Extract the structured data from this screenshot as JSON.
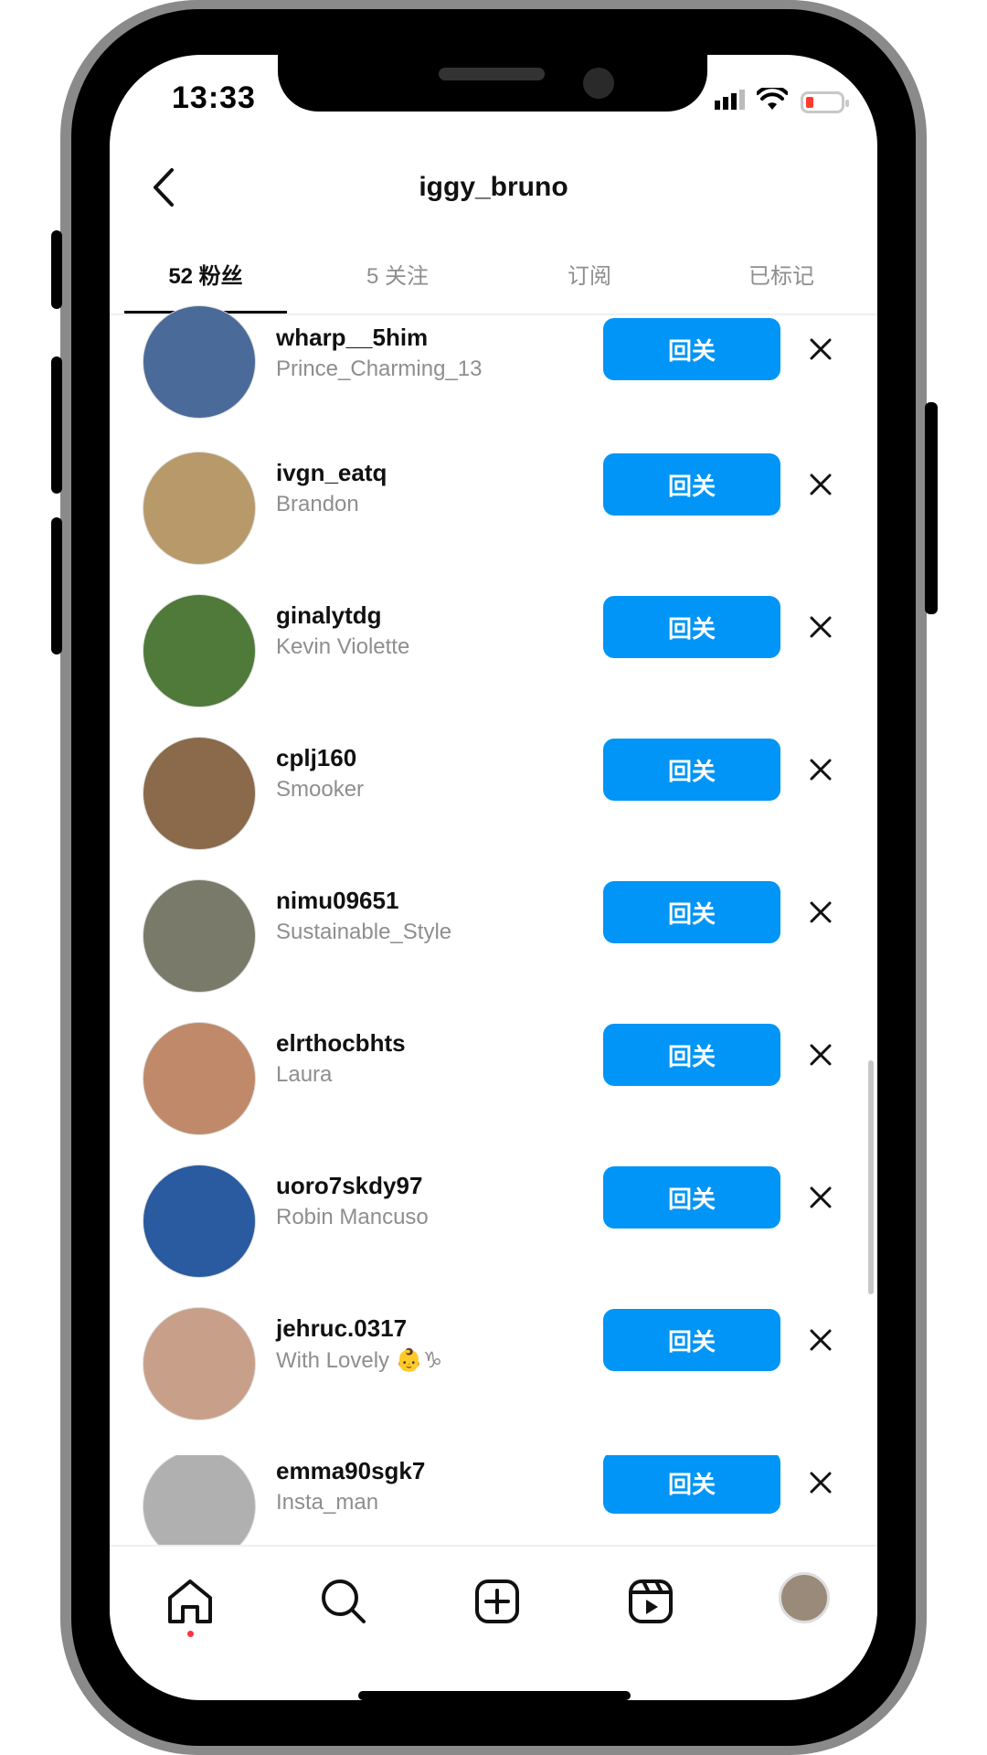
{
  "status_bar": {
    "time": "13:33"
  },
  "header": {
    "title": "iggy_bruno"
  },
  "tabs": [
    {
      "label": "52 粉丝",
      "active": true
    },
    {
      "label": "5 关注",
      "active": false
    },
    {
      "label": "订阅",
      "active": false
    },
    {
      "label": "已标记",
      "active": false
    }
  ],
  "followers": [
    {
      "username": "wharp__5him",
      "name": "Prince_Charming_13",
      "button": "回关",
      "avatar_color": "#4a6a9a"
    },
    {
      "username": "ivgn_eatq",
      "name": "Brandon",
      "button": "回关",
      "avatar_color": "#b89a6a"
    },
    {
      "username": "ginalytdg",
      "name": "Kevin Violette",
      "button": "回关",
      "avatar_color": "#4f7a3a"
    },
    {
      "username": "cplj160",
      "name": "Smooker",
      "button": "回关",
      "avatar_color": "#8a6a4a"
    },
    {
      "username": "nimu09651",
      "name": "Sustainable_Style",
      "button": "回关",
      "avatar_color": "#7a7a6a"
    },
    {
      "username": "elrthocbhts",
      "name": "Laura",
      "button": "回关",
      "avatar_color": "#c08a6a"
    },
    {
      "username": "uoro7skdy97",
      "name": "Robin Mancuso",
      "button": "回关",
      "avatar_color": "#2a5aa0"
    },
    {
      "username": "jehruc.0317",
      "name": "With Lovely 👶♑",
      "button": "回关",
      "avatar_color": "#c8a08a"
    },
    {
      "username": "emma90sgk7",
      "name": "Insta_man",
      "button": "回关",
      "avatar_color": "#b0b0b0"
    }
  ],
  "colors": {
    "accent": "#0095f6",
    "notification_dot": "#ff3040"
  },
  "bottom_nav": [
    "home-icon",
    "search-icon",
    "create-icon",
    "reels-icon",
    "profile-avatar"
  ]
}
